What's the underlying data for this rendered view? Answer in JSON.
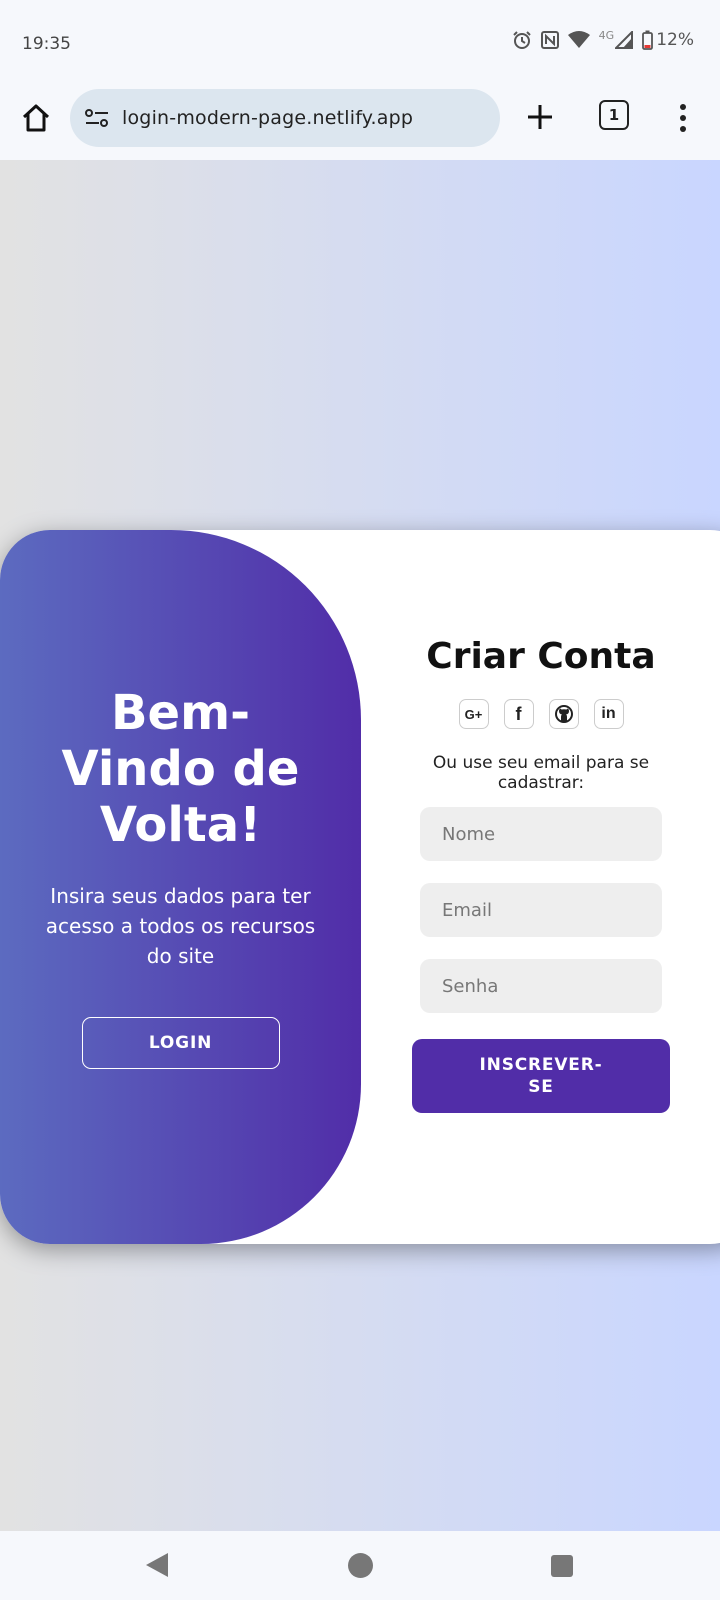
{
  "status_bar": {
    "time": "19:35",
    "network": "4G",
    "battery": "12%"
  },
  "browser": {
    "url": "login-modern-page.netlify.app",
    "tab_count": "1"
  },
  "welcome_panel": {
    "title": "Bem-Vindo de Volta!",
    "text": "Insira seus dados para ter acesso a todos os recursos do site",
    "login_label": "LOGIN"
  },
  "signup_form": {
    "title": "Criar Conta",
    "social_icons": [
      "google-plus",
      "facebook",
      "github",
      "linkedin"
    ],
    "social_labels": {
      "google": "G+",
      "facebook": "f",
      "linkedin": "in"
    },
    "subtitle": "Ou use seu email para se cadastrar:",
    "name_placeholder": "Nome",
    "email_placeholder": "Email",
    "password_placeholder": "Senha",
    "submit_label": "INSCREVER-SE"
  },
  "colors": {
    "accent": "#512da8",
    "gradient_start": "#5c6bc0",
    "background_left": "#e2e2e2",
    "background_right": "#c9d6ff"
  }
}
